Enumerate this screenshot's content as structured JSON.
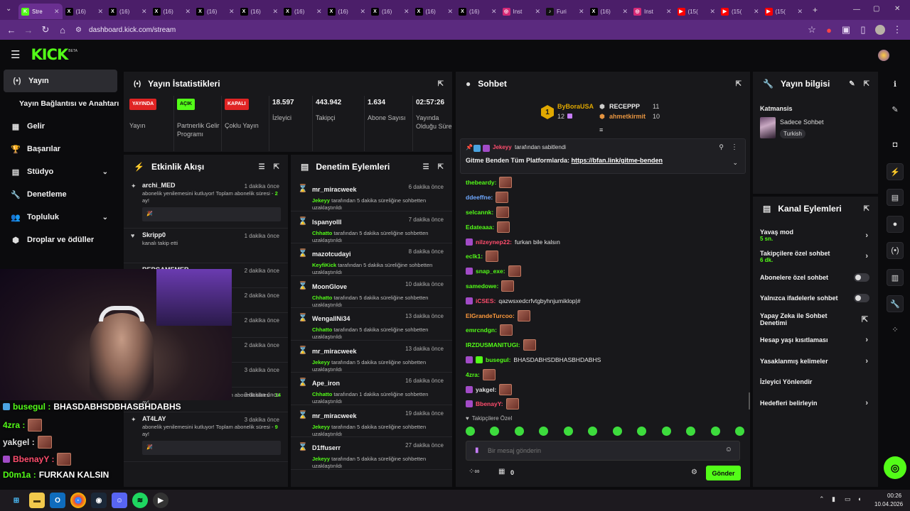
{
  "browser": {
    "tabs": [
      {
        "label": "Stre",
        "icon": "kick-icon",
        "color": "#53fc18",
        "active": true
      },
      {
        "label": "(16)",
        "icon": "x-icon",
        "color": "#000000"
      },
      {
        "label": "(16)",
        "icon": "x-icon",
        "color": "#000000"
      },
      {
        "label": "(16)",
        "icon": "x-icon",
        "color": "#000000"
      },
      {
        "label": "(16)",
        "icon": "x-icon",
        "color": "#000000"
      },
      {
        "label": "(16)",
        "icon": "x-icon",
        "color": "#000000"
      },
      {
        "label": "(16)",
        "icon": "x-icon",
        "color": "#000000"
      },
      {
        "label": "(16)",
        "icon": "x-icon",
        "color": "#000000"
      },
      {
        "label": "(16)",
        "icon": "x-icon",
        "color": "#000000"
      },
      {
        "label": "(16)",
        "icon": "x-icon",
        "color": "#000000"
      },
      {
        "label": "(16)",
        "icon": "x-icon",
        "color": "#000000"
      },
      {
        "label": "Inst",
        "icon": "instagram-icon",
        "color": "#d62976"
      },
      {
        "label": "Furi",
        "icon": "tiktok-icon",
        "color": "#111111"
      },
      {
        "label": "(16)",
        "icon": "x-icon",
        "color": "#000000"
      },
      {
        "label": "Inst",
        "icon": "instagram-icon",
        "color": "#d62976"
      },
      {
        "label": "(15(",
        "icon": "youtube-icon",
        "color": "#ff0000"
      },
      {
        "label": "(15(",
        "icon": "youtube-icon",
        "color": "#ff0000"
      },
      {
        "label": "(15(",
        "icon": "youtube-icon",
        "color": "#ff0000"
      }
    ],
    "url": "dashboard.kick.com/stream"
  },
  "kick": {
    "logo": "KICK",
    "beta": "BETA",
    "accent": "#53fc18"
  },
  "sidebar": {
    "items": [
      {
        "label": "Yayın",
        "icon": "broadcast-icon",
        "active": true
      },
      {
        "label": "Yayın Bağlantısı ve Anahtarı",
        "icon": "",
        "sub": true
      },
      {
        "label": "Gelir",
        "icon": "revenue-icon"
      },
      {
        "label": "Başarılar",
        "icon": "trophy-icon"
      },
      {
        "label": "Stüdyo",
        "icon": "studio-icon",
        "chevron": true
      },
      {
        "label": "Denetleme",
        "icon": "wrench-icon"
      },
      {
        "label": "Topluluk",
        "icon": "community-icon",
        "chevron": true
      },
      {
        "label": "Droplar ve ödüller",
        "icon": "drops-icon"
      }
    ]
  },
  "stats": {
    "title": "Yayın İstatistikleri",
    "cells": [
      {
        "badge": "YAYINDA",
        "badge_color": "#ff3b3b",
        "label": "Yayın"
      },
      {
        "badge": "AÇIK",
        "badge_color": "#53fc18",
        "label": "Partnerlik Gelir Programı"
      },
      {
        "badge": "KAPALI",
        "badge_color": "#ff3b3b",
        "label": "Çoklu Yayın"
      },
      {
        "value": "18.597",
        "label": "İzleyici"
      },
      {
        "value": "443.942",
        "label": "Takipçi"
      },
      {
        "value": "1.634",
        "label": "Abone Sayısı"
      },
      {
        "value": "02:57:26",
        "label": "Yayında Olduğu Süre"
      }
    ]
  },
  "activity": {
    "title": "Etkinlik Akışı",
    "items": [
      {
        "name": "archi_MED",
        "time": "1 dakika önce",
        "msg": "abonelik yenilemesini kutluyor! Toplam abonelik süresi - ",
        "months": "2",
        "suffix": " ay!",
        "note": "🎉",
        "icon": "resub-icon"
      },
      {
        "name": "Skripp0",
        "time": "1 dakika önce",
        "msg": "kanalı takip etti",
        "icon": "heart-icon"
      },
      {
        "name": "REPGAMEMER",
        "time": "2 dakika önce",
        "msg": "",
        "icon": "heart-icon"
      },
      {
        "name": "",
        "time": "2 dakika önce",
        "msg": ""
      },
      {
        "name": "",
        "time": "2 dakika önce",
        "msg": ""
      },
      {
        "name": "",
        "time": "2 dakika önce",
        "msg": ""
      },
      {
        "name": "",
        "time": "3 dakika önce",
        "msg": ""
      },
      {
        "name": "",
        "time": "3 dakika önce",
        "msg": "abonelik yenilemesini kutluyor! Toplam abonelik süresi - ",
        "months": "14",
        "suffix": " ay!"
      },
      {
        "name": "AT4LAY",
        "time": "3 dakika önce",
        "msg": "abonelik yenilemesini kutluyor! Toplam abonelik süresi - ",
        "months": "9",
        "suffix": " ay!",
        "note": "🎉",
        "icon": "resub-icon"
      }
    ]
  },
  "moderation": {
    "title": "Denetim Eylemleri",
    "items": [
      {
        "name": "mr_miracweek",
        "time": "6 dakika önce",
        "by": "Jekeyy",
        "desc": "tarafından 5 dakika süreliğine sohbetten uzaklaştırıldı"
      },
      {
        "name": "lspanyolll",
        "time": "7 dakika önce",
        "by": "Chhatto",
        "desc": "tarafından 5 dakika süreliğine sohbetten uzaklaştırıldı"
      },
      {
        "name": "mazotcudayi",
        "time": "8 dakika önce",
        "by": "KeyfiKick",
        "desc": "tarafından 5 dakika süreliğine sohbetten uzaklaştırıldı"
      },
      {
        "name": "MoonGlove",
        "time": "10 dakika önce",
        "by": "Chhatto",
        "desc": "tarafından 5 dakika süreliğine sohbetten uzaklaştırıldı"
      },
      {
        "name": "WengallNi34",
        "time": "13 dakika önce",
        "by": "Chhatto",
        "desc": "tarafından 5 dakika süreliğine sohbetten uzaklaştırıldı"
      },
      {
        "name": "mr_miracweek",
        "time": "13 dakika önce",
        "by": "Jekeyy",
        "desc": "tarafından 5 dakika süreliğine sohbetten uzaklaştırıldı"
      },
      {
        "name": "Ape_iron",
        "time": "16 dakika önce",
        "by": "Chhatto",
        "desc": "tarafından 1 dakika süreliğine sohbetten uzaklaştırıldı"
      },
      {
        "name": "mr_miracweek",
        "time": "19 dakika önce",
        "by": "Jekeyy",
        "desc": "tarafından 5 dakika süreliğine sohbetten uzaklaştırıldı"
      },
      {
        "name": "D1ffuserr",
        "time": "27 dakika önce",
        "by": "Jekeyy",
        "desc": "tarafından 5 dakika süreliğine sohbetten uzaklaştırıldı"
      }
    ]
  },
  "chat": {
    "title": "Sohbet",
    "leaders": {
      "first": {
        "rank": "1",
        "name": "ByBoraUSA",
        "count": "12"
      },
      "second": {
        "name": "RECEPPP",
        "count": "11"
      },
      "third": {
        "name": "ahmetkirmit",
        "count": "10"
      }
    },
    "pinned": {
      "by": "Jekeyy",
      "label": "tarafından sabitlendi",
      "text": "Gitme Benden Tüm Platformlarda: ",
      "link": "https://bfan.link/gitme-benden"
    },
    "messages": [
      {
        "user": "thebeardy:",
        "color": "#53fc18",
        "text": "",
        "emote": true
      },
      {
        "user": "ddeeffne:",
        "color": "#6fa8ff",
        "text": "",
        "emote": true
      },
      {
        "user": "selcannk:",
        "color": "#53fc18",
        "text": "",
        "emote": true
      },
      {
        "user": "Edateaaa:",
        "color": "#53fc18",
        "text": "",
        "emote": true
      },
      {
        "user": "nilzeynep22:",
        "color": "#ff4d6d",
        "text": "furkan bile kalsın",
        "emote": false,
        "badges": 1
      },
      {
        "user": "eclk1:",
        "color": "#53fc18",
        "text": "",
        "emote": true
      },
      {
        "user": "snap_exe:",
        "color": "#53fc18",
        "text": "",
        "emote": true,
        "badges": 1
      },
      {
        "user": "samedowe:",
        "color": "#53fc18",
        "text": "",
        "emote": true
      },
      {
        "user": "iCSES:",
        "color": "#ff4d6d",
        "text": "qazwsxedcrfvtgbyhnjumiklop|#",
        "emote": false,
        "badges": 1
      },
      {
        "user": "ElGrandeTurcoo:",
        "color": "#ff9a3c",
        "text": "",
        "emote": true
      },
      {
        "user": "emrcndgn:",
        "color": "#53fc18",
        "text": "",
        "emote": true
      },
      {
        "user": "IRZDUSMANITUGI:",
        "color": "#53fc18",
        "text": "",
        "emote": true
      },
      {
        "user": "busegul:",
        "color": "#53fc18",
        "text": "BHASDABHSDBHASBHDABHS",
        "emote": false,
        "badges": 2
      },
      {
        "user": "4zra:",
        "color": "#53fc18",
        "text": "",
        "emote": true
      },
      {
        "user": "yakgel:",
        "color": "#e0e0e0",
        "text": "",
        "emote": true,
        "badges": 1
      },
      {
        "user": "BbenayY:",
        "color": "#ff4d6d",
        "text": "",
        "emote": true,
        "badges": 1
      }
    ],
    "followers_only": "Takipçilere Özel",
    "placeholder": "Bir mesaj gönderin",
    "points": "0",
    "send": "Gönder"
  },
  "stream_info": {
    "title": "Yayın bilgisi",
    "category": "Katmansis",
    "mode": "Sadece Sohbet",
    "lang": "Turkish"
  },
  "channel_actions": {
    "title": "Kanal Eylemleri",
    "rows": [
      {
        "label": "Yavaş mod",
        "sub": "5 sn.",
        "type": "chevron"
      },
      {
        "label": "Takipçilere özel sohbet",
        "sub": "6 dk.",
        "type": "chevron"
      },
      {
        "label": "Abonelere özel sohbet",
        "type": "toggle"
      },
      {
        "label": "Yalnızca ifadelerle sohbet",
        "type": "toggle"
      },
      {
        "label": "Yapay Zeka ile Sohbet Denetimi",
        "type": "external"
      },
      {
        "label": "Hesap yaşı kısıtlaması",
        "type": "chevron"
      },
      {
        "label": "Yasaklanmış kelimeler",
        "type": "chevron"
      },
      {
        "label": "İzleyici Yönlendir",
        "type": "none"
      },
      {
        "label": "Hedefleri belirleyin",
        "type": "chevron"
      }
    ]
  },
  "overlay": {
    "lines": [
      {
        "user": "busegul :",
        "text": " BHASDABHSDBHASBHDABHS",
        "color": "#53fc18"
      },
      {
        "user": "4zra :",
        "text": "",
        "color": "#53fc18"
      },
      {
        "user": "yakgel :",
        "text": "",
        "color": "#e0e0e0"
      },
      {
        "user": "BbenayY :",
        "text": "",
        "color": "#ff4d6d"
      },
      {
        "user": "D0m1a :",
        "text": " FURKAN KALSIN",
        "color": "#53fc18"
      }
    ]
  },
  "taskbar": {
    "time": "00:26",
    "date": "10.04.2026"
  }
}
